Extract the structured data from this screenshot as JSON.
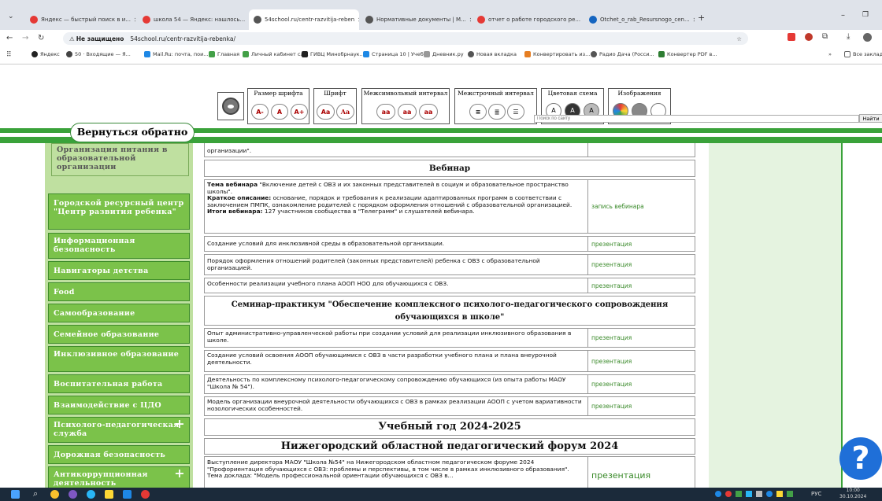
{
  "browser": {
    "tabs": [
      {
        "label": "Яндекс — быстрый поиск в и...",
        "color": "#e53935"
      },
      {
        "label": "школа 54 — Яндекс: нашлось...",
        "color": "#e53935"
      },
      {
        "label": "54school.ru/centr-razvitija-reben",
        "color": "#555555"
      },
      {
        "label": "Нормативные документы | М...",
        "color": "#555555"
      },
      {
        "label": "отчет о работе городского ре...",
        "color": "#e53935"
      },
      {
        "label": "Otchet_o_rab_Resursnogo_cen...",
        "color": "#1565c0"
      }
    ],
    "url_prefix": "Не защищено",
    "url": "54school.ru/centr-razvitija-rebenka/",
    "bookmarks": [
      "Яндекс",
      "50 · Входящие — Я...",
      "Mail.Ru: почта, пои...",
      "Главная",
      "Личный кабинет сл...",
      "ГИВЦ Минобрнаук...",
      "Страница 10 | Учеб...",
      "Дневник.ру",
      "Новая вкладка",
      "Конвертировать из...",
      "Радио Дача (Росси...",
      "Конвертер PDF в..."
    ],
    "bookmarks_end": "Все закладки"
  },
  "toolbar": {
    "font_size": {
      "title": "Размер шрифта",
      "buttons": [
        "A-",
        "A",
        "A+"
      ]
    },
    "font": {
      "title": "Шрифт",
      "buttons": [
        "Aa",
        "Aa"
      ]
    },
    "letter_spacing": {
      "title": "Межсимвольный интервал",
      "buttons": [
        "aa",
        "aa",
        "aa"
      ]
    },
    "line_spacing": {
      "title": "Межстрочный интервал"
    },
    "color_scheme": {
      "title": "Цветовая схема",
      "buttons": [
        "A",
        "A",
        "A"
      ]
    },
    "images": {
      "title": "Изображения"
    }
  },
  "search": {
    "placeholder": "Поиск по сайту",
    "button": "Найти"
  },
  "back_button": "Вернуться обратно",
  "menu": [
    "Организация питания в образовательной организации",
    "Городской ресурсный центр \"Центр развития ребенка\"",
    "Информационная безопасность",
    "Навигаторы детства",
    "Food",
    "Самообразование",
    "Семейное образование",
    "Инклюзивное образование",
    "Воспитательная работа",
    "Взаимодействие с ЦДО",
    "Психолого-педагогическая служба",
    "Дорожная безопасность",
    "Антикоррупционная деятельность"
  ],
  "content": {
    "top_fragment": "организации\".",
    "webinar_header": "Вебинар",
    "webinar": {
      "topic_label": "Тема вебинара",
      "topic": "\"Включение детей с ОВЗ и их законных представителей в социум и образовательное пространство школы\".",
      "desc_label": "Краткое описание:",
      "desc": "основание, порядок и требования к реализации адаптированных программ в соответствии с заключением ПМПК, ознакомление родителей с порядком оформления отношений с образовательной организацией.",
      "result_label": "Итоги вебинара:",
      "result": "127 участников сообщества в \"Телеграмм\" и слушателей вебинара.",
      "link": "запись вебинара"
    },
    "rows1": [
      {
        "text": "Создание условий для инклюзивной среды в образовательной организации.",
        "link": "презентация"
      },
      {
        "text": "Порядок оформления отношений родителей (законных представителей) ребенка с ОВЗ с образовательной организацией.",
        "link": "презентация"
      },
      {
        "text": "Особенности реализации учебного плана АООП НОО для обучающихся с ОВЗ.",
        "link": "презентация"
      }
    ],
    "seminar_header": "Семинар-практикум \"Обеспечение комплексного психолого-педагогического сопровождения обучающихся в школе\"",
    "rows2": [
      {
        "text": "Опыт административно-управленческой работы при создании условий для реализации инклюзивного образования в школе.",
        "link": "презентация"
      },
      {
        "text": "Создание условий освоения АООП обучающимися с ОВЗ в части разработки учебного плана и плана внеурочной деятельности.",
        "link": "презентация"
      },
      {
        "text": "Деятельность по комплексному психолого-педагогическому сопровождению обучающихся (из опыта работы МАОУ \"Школа № 54\").",
        "link": "презентация"
      },
      {
        "text": "Модель организации внеурочной деятельности обучающихся с ОВЗ в рамках реализации АООП с учетом вариативности нозологических особенностей.",
        "link": "презентация"
      }
    ],
    "year_header": "Учебный год 2024-2025",
    "forum_header": "Нижегородский областной педагогический форум 2024",
    "forum_text": "Выступление директора МАОУ \"Школа №54\" на Нижегородском областном педагогическом форуме 2024 \"Профориентация обучающихся с ОВЗ: проблемы и перспективы, в том числе в рамках инклюзивного образования\". Тема доклада: \"Модель профессиональной ориентации обучающихся с ОВЗ в...",
    "forum_link": "презентация"
  },
  "help": "?",
  "tray": {
    "lang": "РУС",
    "time": "10:00",
    "date": "30.10.2024"
  }
}
